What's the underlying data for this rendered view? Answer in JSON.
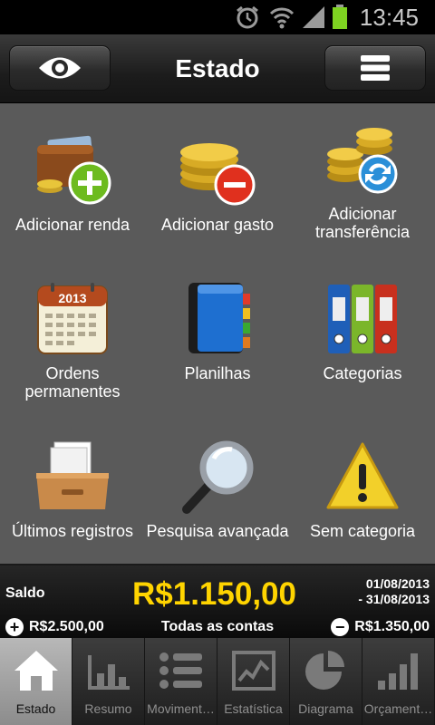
{
  "status_bar": {
    "time": "13:45",
    "icons": [
      "alarm-icon",
      "wifi-icon",
      "signal-icon",
      "battery-icon"
    ]
  },
  "header": {
    "title": "Estado",
    "left_icon": "eye-icon",
    "right_icon": "menu-icon"
  },
  "grid": {
    "items": [
      {
        "label": "Adicionar renda",
        "icon": "wallet-add-icon"
      },
      {
        "label": "Adicionar gasto",
        "icon": "coins-remove-icon"
      },
      {
        "label": "Adicionar transferência",
        "icon": "coins-transfer-icon"
      },
      {
        "label": "Ordens permanentes",
        "icon": "calendar-icon",
        "calendar_year": "2013"
      },
      {
        "label": "Planilhas",
        "icon": "notebook-icon"
      },
      {
        "label": "Categorias",
        "icon": "binders-icon"
      },
      {
        "label": "Últimos registros",
        "icon": "drawer-icon"
      },
      {
        "label": "Pesquisa avançada",
        "icon": "magnifier-icon"
      },
      {
        "label": "Sem categoria",
        "icon": "warning-icon"
      }
    ]
  },
  "summary": {
    "saldo_label": "Saldo",
    "saldo_value": "R$1.150,00",
    "date_from": "01/08/2013",
    "date_to": "- 31/08/2013",
    "income": "R$2.500,00",
    "account_filter": "Todas as contas",
    "expense": "R$1.350,00",
    "colors": {
      "saldo": "#ffd400"
    }
  },
  "tabs": [
    {
      "label": "Estado",
      "icon": "home-icon",
      "active": true
    },
    {
      "label": "Resumo",
      "icon": "bar-chart-icon",
      "active": false
    },
    {
      "label": "Moviment…",
      "icon": "list-icon",
      "active": false
    },
    {
      "label": "Estatística",
      "icon": "line-chart-icon",
      "active": false
    },
    {
      "label": "Diagrama",
      "icon": "pie-chart-icon",
      "active": false
    },
    {
      "label": "Orçament…",
      "icon": "budget-bars-icon",
      "active": false
    }
  ]
}
